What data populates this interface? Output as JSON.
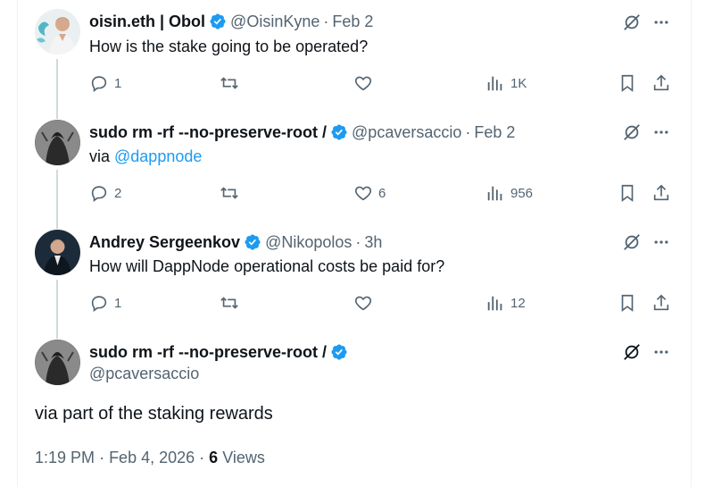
{
  "tweets": [
    {
      "name": "oisin.eth | Obol",
      "handle": "@OisinKyne",
      "date": "Feb 2",
      "text": "How is the stake going to be operated?",
      "replies": "1",
      "reposts": "",
      "likes": "",
      "views": "1K"
    },
    {
      "name": "sudo rm -rf --no-preserve-root /",
      "handle": "@pcaversaccio",
      "date": "Feb 2",
      "text_prefix": "via ",
      "mention": "@dappnode",
      "replies": "2",
      "reposts": "",
      "likes": "6",
      "views": "956"
    },
    {
      "name": "Andrey Sergeenkov",
      "handle": "@Nikopolos",
      "date": "3h",
      "text": "How will DappNode operational costs be paid for?",
      "replies": "1",
      "reposts": "",
      "likes": "",
      "views": "12"
    }
  ],
  "main_tweet": {
    "name": "sudo rm -rf --no-preserve-root /",
    "handle": "@pcaversaccio",
    "text": "via part of the staking rewards",
    "time": "1:19 PM",
    "date": "Feb 4, 2026",
    "views_count": "6",
    "views_label": "Views"
  },
  "colors": {
    "verified": "#1d9bf0",
    "mention": "#1d9bf0",
    "secondary_text": "#536471",
    "thread_line": "#cfd9de"
  },
  "icons": [
    "verified-badge-icon",
    "grok-icon",
    "more-icon",
    "reply-icon",
    "repost-icon",
    "like-icon",
    "views-icon",
    "bookmark-icon",
    "share-icon"
  ]
}
